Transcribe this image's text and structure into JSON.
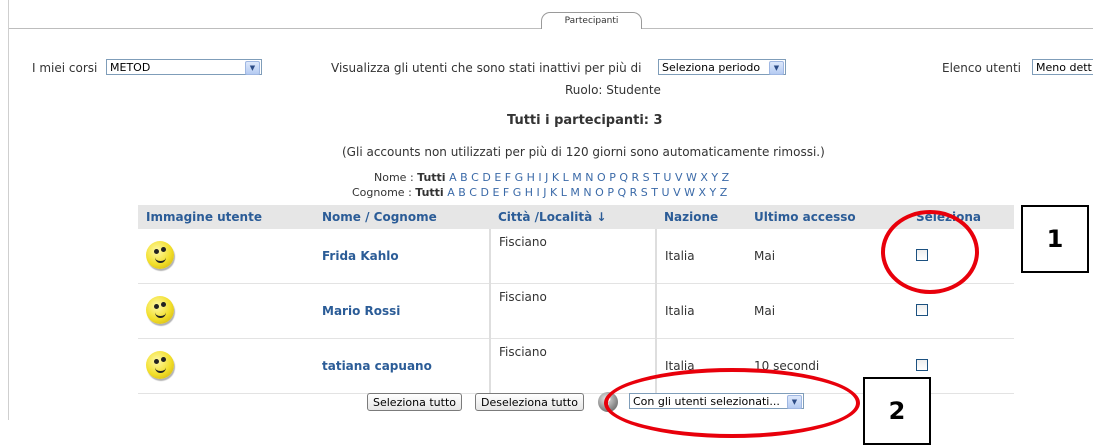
{
  "tab": {
    "label": "Partecipanti"
  },
  "courses": {
    "label": "I miei corsi",
    "selected": "METOD"
  },
  "inactive": {
    "label": "Visualizza gli utenti che sono stati inattivi per più di",
    "selected": "Seleziona periodo"
  },
  "user_list": {
    "label": "Elenco utenti",
    "selected": "Meno dett"
  },
  "role": "Ruolo: Studente",
  "total": "Tutti i partecipanti: 3",
  "note": "(Gli accounts non utilizzati per più di 120 giorni sono automaticamente rimossi.)",
  "filters": {
    "first_name_label": "Nome :",
    "last_name_label": "Cognome :",
    "all": "Tutti",
    "letters": [
      "A",
      "B",
      "C",
      "D",
      "E",
      "F",
      "G",
      "H",
      "I",
      "J",
      "K",
      "L",
      "M",
      "N",
      "O",
      "P",
      "Q",
      "R",
      "S",
      "T",
      "U",
      "V",
      "W",
      "X",
      "Y",
      "Z"
    ]
  },
  "table": {
    "headers": {
      "image": "Immagine utente",
      "name": "Nome / Cognome",
      "city": "Città /Località ↓",
      "country": "Nazione",
      "last_access": "Ultimo accesso",
      "select": "Seleziona"
    },
    "rows": [
      {
        "name": "Frida Kahlo",
        "city": "Fisciano",
        "country": "Italia",
        "last_access": "Mai"
      },
      {
        "name": "Mario Rossi",
        "city": "Fisciano",
        "country": "Italia",
        "last_access": "Mai"
      },
      {
        "name": "tatiana capuano",
        "city": "Fisciano",
        "country": "Italia",
        "last_access": "10 secondi"
      }
    ]
  },
  "actions": {
    "select_all": "Seleziona tutto",
    "deselect_all": "Deseleziona tutto",
    "with_selected": "Con gli utenti selezionati..."
  },
  "annotations": {
    "callout_1": "1",
    "callout_2": "2",
    "highlight_color": "#e8000b"
  },
  "icons": {
    "avatar": "smiley-avatar-icon",
    "help": "help-icon",
    "dropdown": "chevron-down-icon"
  }
}
